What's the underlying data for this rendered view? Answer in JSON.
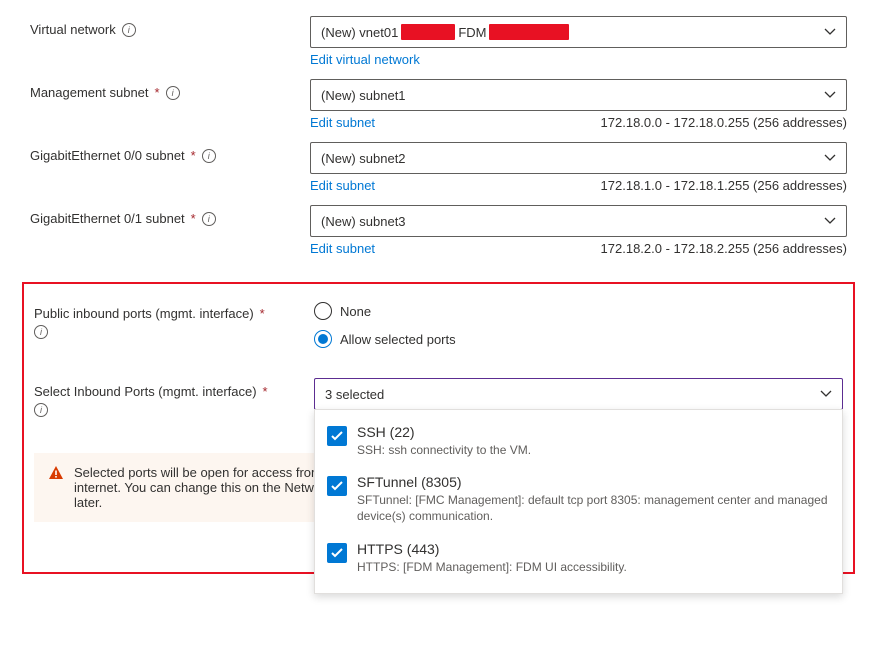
{
  "vnet": {
    "label": "Virtual network",
    "value_prefix": "(New) vnet01",
    "value_mid": "FDM",
    "edit_link": "Edit virtual network"
  },
  "subnets": [
    {
      "label": "Management subnet",
      "required": true,
      "value": "(New) subnet1",
      "edit_link": "Edit subnet",
      "range": "172.18.0.0 - 172.18.0.255 (256 addresses)"
    },
    {
      "label": "GigabitEthernet 0/0 subnet",
      "required": true,
      "value": "(New) subnet2",
      "edit_link": "Edit subnet",
      "range": "172.18.1.0 - 172.18.1.255 (256 addresses)"
    },
    {
      "label": "GigabitEthernet 0/1 subnet",
      "required": true,
      "value": "(New) subnet3",
      "edit_link": "Edit subnet",
      "range": "172.18.2.0 - 172.18.2.255 (256 addresses)"
    }
  ],
  "inbound": {
    "label": "Public inbound ports (mgmt. interface)",
    "options": {
      "none": "None",
      "allow": "Allow selected ports"
    }
  },
  "selectPorts": {
    "label": "Select Inbound Ports (mgmt. interface)",
    "summary": "3 selected",
    "items": [
      {
        "title": "SSH (22)",
        "desc": "SSH: ssh connectivity to the VM."
      },
      {
        "title": "SFTunnel (8305)",
        "desc": "SFTunnel: [FMC Management]: default tcp port 8305: management center and managed device(s) communication."
      },
      {
        "title": "HTTPS (443)",
        "desc": "HTTPS: [FDM Management]: FDM UI accessibility."
      }
    ]
  },
  "warning": "Selected ports will be open for access from the internet. You can change this on the Networking page later."
}
